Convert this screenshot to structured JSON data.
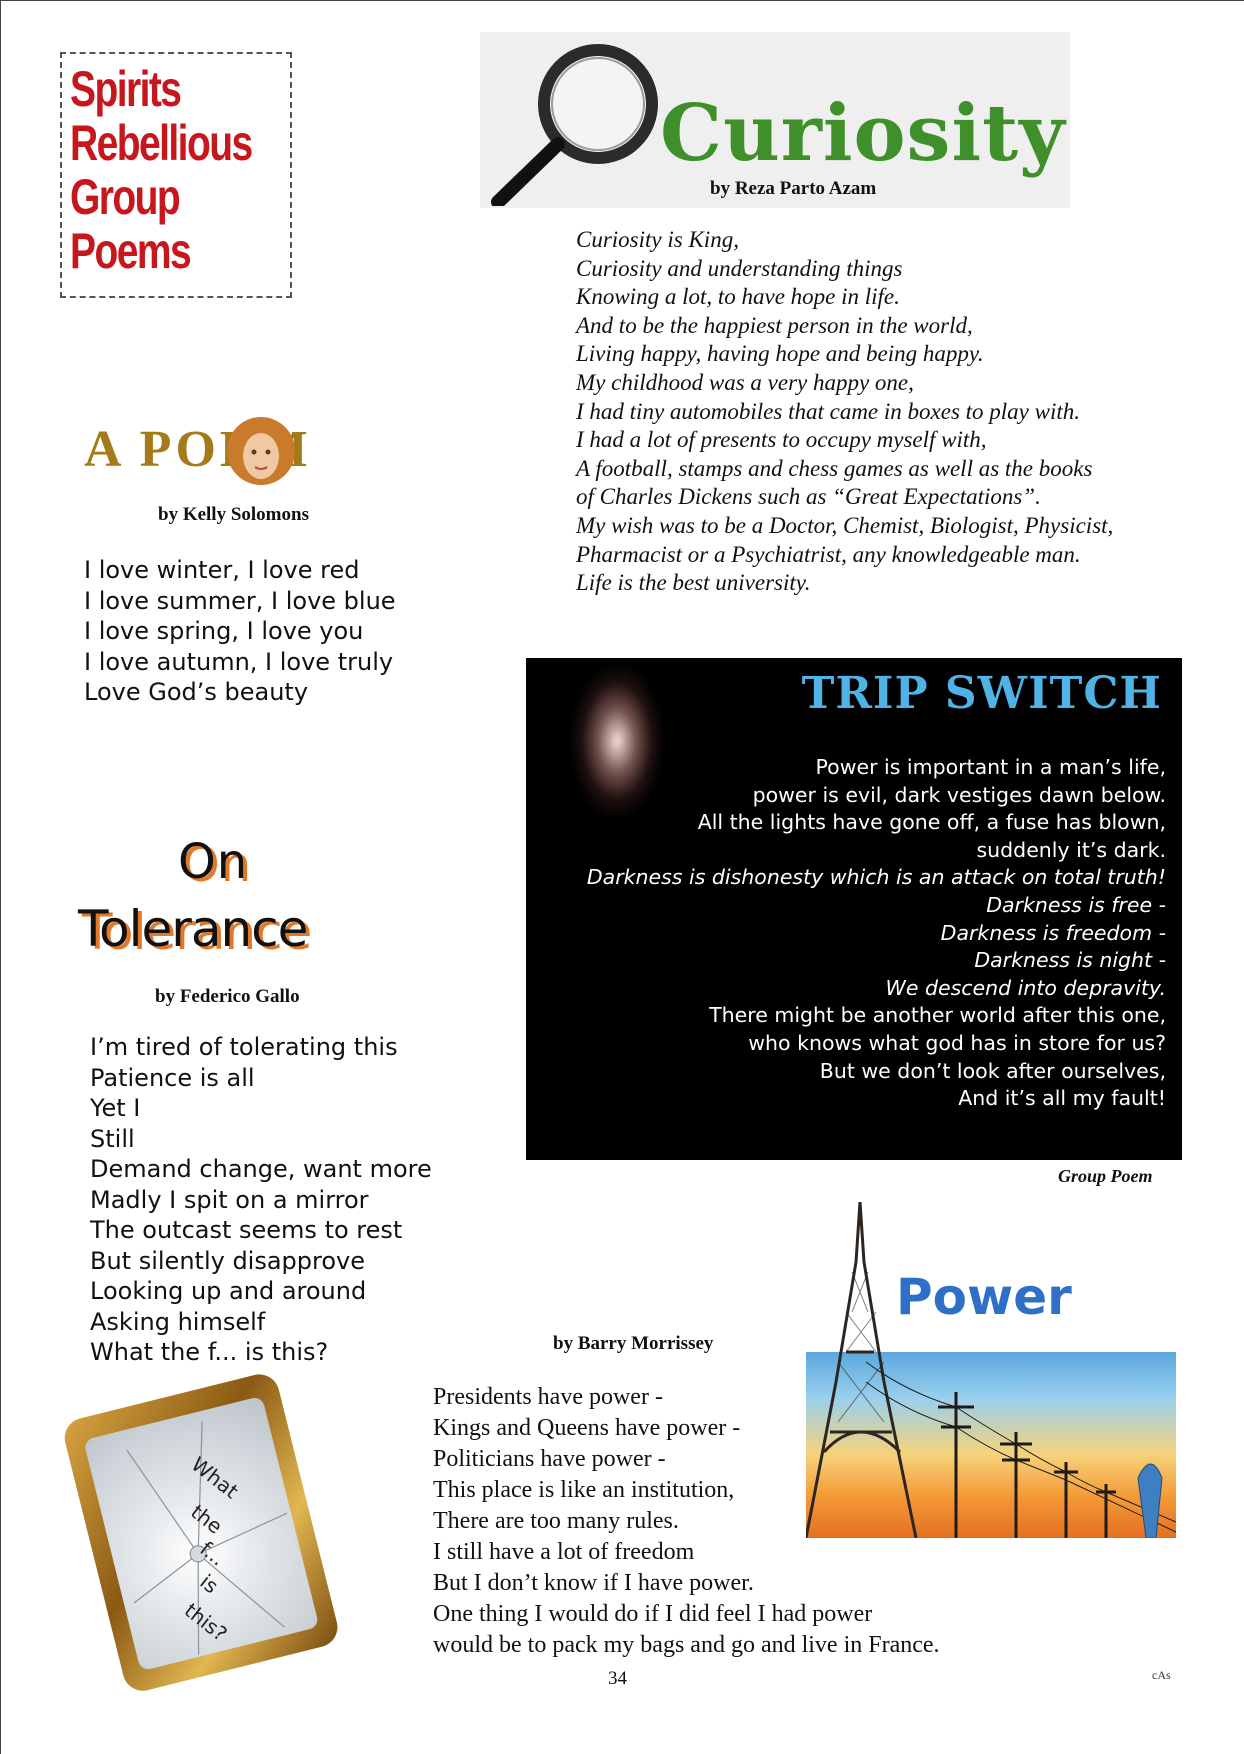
{
  "group_title": [
    "Spirits",
    "Rebellious",
    "Group",
    "Poems"
  ],
  "curiosity": {
    "title": "Curiosity",
    "byline": "by Reza Parto Azam",
    "lines": [
      "Curiosity is King,",
      "Curiosity and understanding things",
      "Knowing a lot, to have hope in life.",
      "And to be the happiest person in the world,",
      "Living happy, having hope and being happy.",
      "My childhood was a very happy one,",
      "I had tiny automobiles that came in boxes to play with.",
      "I had a lot of presents to occupy myself with,",
      "A football, stamps and chess games as well as the books",
      "of Charles Dickens such as “Great Expectations”.",
      "My wish was to be a Doctor, Chemist, Biologist, Physicist,",
      "Pharmacist or a Psychiatrist, any knowledgeable man.",
      "Life is the best university."
    ]
  },
  "a_poem": {
    "title": "A POEM",
    "byline": "by Kelly Solomons",
    "lines": [
      "I love winter, I love red",
      "I love summer, I love blue",
      "I love spring, I love you",
      "I love autumn, I love truly",
      "Love God’s beauty"
    ]
  },
  "trip_switch": {
    "title": "TRIP SWITCH",
    "lines": [
      {
        "text": "Power is important in a man’s life,",
        "italic": false
      },
      {
        "text": "power is evil, dark vestiges dawn below.",
        "italic": false
      },
      {
        "text": "All the lights have gone off, a fuse has blown,",
        "italic": false
      },
      {
        "text": "suddenly it’s dark.",
        "italic": false
      },
      {
        "text": "Darkness is dishonesty which is an attack on total truth!",
        "italic": true
      },
      {
        "text": "Darkness is free -",
        "italic": true
      },
      {
        "text": "Darkness is freedom -",
        "italic": true
      },
      {
        "text": "Darkness is night -",
        "italic": true
      },
      {
        "text": "We descend into depravity.",
        "italic": true
      },
      {
        "text": "There might be another world after this one,",
        "italic": false
      },
      {
        "text": "who knows what god has in store for us?",
        "italic": false
      },
      {
        "text": "But we don’t look after ourselves,",
        "italic": false
      },
      {
        "text": "And it’s all my fault!",
        "italic": false
      }
    ],
    "credit": "Group Poem"
  },
  "on_tolerance": {
    "title_line1": "On",
    "title_line2": "Tolerance",
    "byline": "by Federico Gallo",
    "lines": [
      "I’m tired of tolerating this",
      "Patience is all",
      "Yet I",
      "Still",
      "Demand change, want more",
      "Madly I spit on a mirror",
      "The outcast seems to rest",
      "But silently disapprove",
      "Looking up and around",
      "Asking himself",
      "What the f... is this?"
    ],
    "mirror_words": [
      "What",
      "the",
      "f...",
      "is",
      "this?"
    ]
  },
  "power": {
    "image_word": "Power",
    "byline": "by Barry Morrissey",
    "lines": [
      "Presidents have power -",
      "Kings and Queens have power -",
      "Politicians have power -",
      "This place is like an institution,",
      "There are too many rules.",
      "I still have a lot of freedom",
      "But I don’t know if I have power.",
      "One thing I would do if I did feel I had power",
      "would be to pack my bags and go and live in France."
    ]
  },
  "page_number": "34",
  "corner_mark": "cAs",
  "colors": {
    "group_title_red": "#c8161d",
    "curiosity_green": "#3f8f2b",
    "apoem_gold": "#a57a18",
    "trip_blue": "#4fb3e6",
    "tolerance_orange": "#e07a2a",
    "power_blue": "#2e6fc7"
  }
}
